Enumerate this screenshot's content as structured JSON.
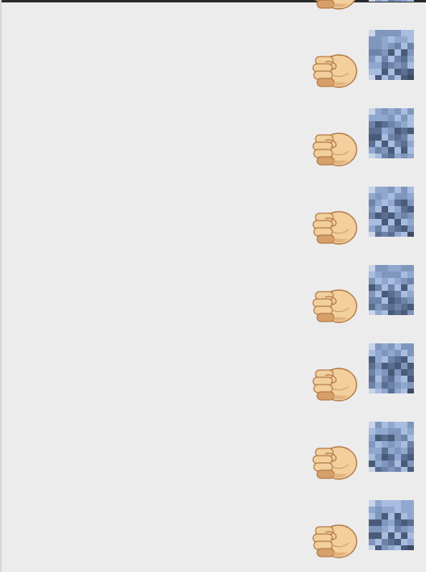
{
  "conversation": {
    "messages": [
      {
        "sender": "self",
        "content": "fist-bump-sticker",
        "avatar": "pixelated-avatar"
      },
      {
        "sender": "self",
        "content": "fist-bump-sticker",
        "avatar": "pixelated-avatar"
      },
      {
        "sender": "self",
        "content": "fist-bump-sticker",
        "avatar": "pixelated-avatar"
      },
      {
        "sender": "self",
        "content": "fist-bump-sticker",
        "avatar": "pixelated-avatar"
      },
      {
        "sender": "self",
        "content": "fist-bump-sticker",
        "avatar": "pixelated-avatar"
      },
      {
        "sender": "self",
        "content": "fist-bump-sticker",
        "avatar": "pixelated-avatar"
      },
      {
        "sender": "self",
        "content": "fist-bump-sticker",
        "avatar": "pixelated-avatar"
      },
      {
        "sender": "self",
        "content": "fist-bump-sticker",
        "avatar": "pixelated-avatar"
      }
    ]
  },
  "colors": {
    "background": "#ececec",
    "fist_skin": "#f2cf9d",
    "fist_shadow": "#d7a06a",
    "fist_outline": "#b47a47",
    "avatar_palette": [
      "#5b6f93",
      "#6d83a8",
      "#7f96bd",
      "#90a8cf",
      "#a8bde0",
      "#4a5b7a",
      "#c7d4ea",
      "#3e4a63"
    ]
  }
}
